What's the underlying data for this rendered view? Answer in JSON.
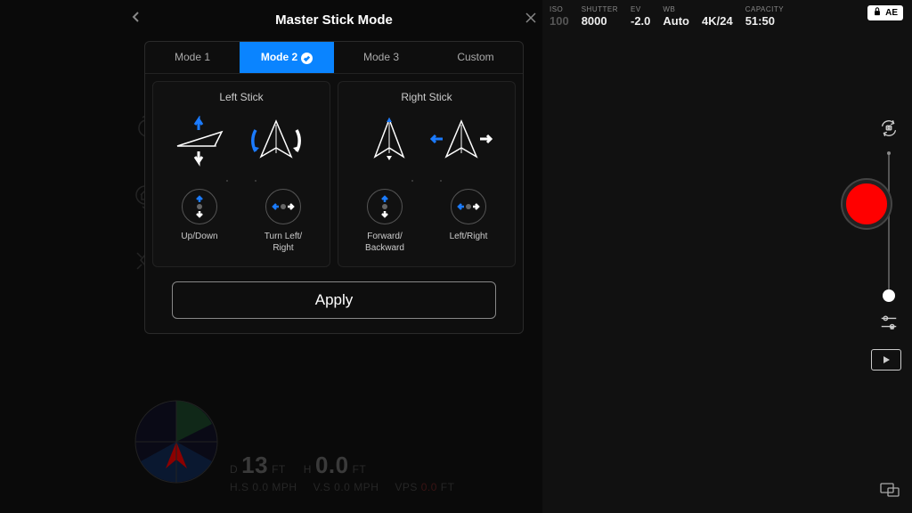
{
  "header": {
    "title": "Master Stick Mode"
  },
  "tabs": [
    "Mode 1",
    "Mode 2",
    "Mode 3",
    "Custom"
  ],
  "active_tab": 1,
  "sticks": {
    "left": {
      "title": "Left Stick",
      "ctrl1": "Up/Down",
      "ctrl2": "Turn Left/\nRight"
    },
    "right": {
      "title": "Right Stick",
      "ctrl1": "Forward/\nBackward",
      "ctrl2": "Left/Right"
    }
  },
  "apply_label": "Apply",
  "camera": {
    "iso": {
      "label": "ISO",
      "value": "100"
    },
    "shutter": {
      "label": "SHUTTER",
      "value": "8000"
    },
    "ev": {
      "label": "EV",
      "value": "-2.0"
    },
    "wb": {
      "label": "WB",
      "value": "Auto"
    },
    "format": {
      "label": "",
      "value": "4K/24"
    },
    "capacity": {
      "label": "CAPACITY",
      "value": "51:50"
    },
    "ae": "AE"
  },
  "telemetry": {
    "d_lbl": "D",
    "d_val": "13",
    "d_unit": "FT",
    "h_lbl": "H",
    "h_val": "0.0",
    "h_unit": "FT",
    "hs_lbl": "H.S",
    "hs_val": "0.0",
    "hs_unit": "MPH",
    "vs_lbl": "V.S",
    "vs_val": "0.0",
    "vs_unit": "MPH",
    "vps_lbl": "VPS",
    "vps_val": "0.0",
    "vps_unit": "FT"
  }
}
